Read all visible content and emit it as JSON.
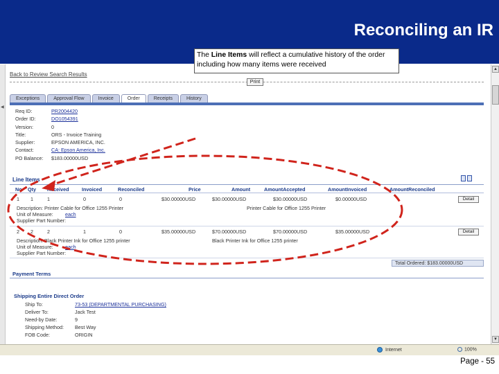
{
  "slide": {
    "title": "Reconciling an IR",
    "page": "Page - 55"
  },
  "nav": {
    "back_link": "Back to Review Search Results",
    "print_button": "Print"
  },
  "tabs": [
    "Exceptions",
    "Approval Flow",
    "Invoice",
    "Order",
    "Receipts",
    "History"
  ],
  "active_tab": "Order",
  "fields": [
    {
      "label": "Req ID:",
      "value": "PR2004420",
      "link": true
    },
    {
      "label": "Order ID:",
      "value": "DO1054391",
      "link": true
    },
    {
      "label": "Version:",
      "value": "0",
      "link": false
    },
    {
      "label": "Title:",
      "value": "ORS - Invoice Training",
      "link": false
    },
    {
      "label": "Supplier:",
      "value": "EPSON AMERICA, INC.",
      "link": false
    },
    {
      "label": "Contact:",
      "value": "CA: Epson America, Inc.",
      "link": true
    },
    {
      "label": "PO Balance:",
      "value": "$183.00000USD",
      "link": false
    }
  ],
  "callout": {
    "prefix": "The ",
    "bold": "Line Items",
    "suffix": " will reflect a cumulative history of the order including how many items were received"
  },
  "line_items": {
    "title": "Line Items",
    "columns": [
      "No",
      "Qty",
      "Received",
      "Invoiced",
      "Reconciled",
      "Price",
      "Amount",
      "AmountAccepted",
      "AmountInvoiced",
      "AmountReconciled"
    ],
    "rows": [
      {
        "no": "1",
        "qty": "1",
        "received": "1",
        "invoiced": "0",
        "reconciled": "0",
        "price": "$30.00000USD",
        "amount": "$30.00000USD",
        "amount_accepted": "$30.00000USD",
        "amount_invoiced": "$0.00000USD",
        "detail": "Detail",
        "description": "Description: Printer Cable for Office 1255 Printer",
        "description_right": "Printer Cable for Office 1255 Printer",
        "uom_label": "Unit of Measure:",
        "uom": "each",
        "part_label": "Supplier Part Number:"
      },
      {
        "no": "2",
        "qty": "2",
        "received": "2",
        "invoiced": "1",
        "reconciled": "0",
        "price": "$35.00000USD",
        "amount": "$70.00000USD",
        "amount_accepted": "$70.00000USD",
        "amount_invoiced": "$35.00000USD",
        "detail": "Detail",
        "description": "Description: Black Printer Ink for Office 1255 printer",
        "description_right": "Black Printer Ink for Office 1255 printer",
        "uom_label": "Unit of Measure:",
        "uom": "each",
        "part_label": "Supplier Part Number:"
      }
    ],
    "total_ordered": "Total Ordered: $183.00000USD"
  },
  "payment_terms": {
    "title": "Payment Terms"
  },
  "shipping": {
    "title": "Shipping  Entire Direct Order",
    "rows": [
      {
        "label": "Ship To:",
        "value": "73-53 (DEPARTMENTAL PURCHASING)",
        "link": true
      },
      {
        "label": "Deliver To:",
        "value": "Jack Test",
        "link": false
      },
      {
        "label": "Need-by Date:",
        "value": "9",
        "link": false
      },
      {
        "label": "Shipping Method:",
        "value": "Best Way",
        "link": false
      },
      {
        "label": "FOB Code:",
        "value": "ORIGIN",
        "link": false
      }
    ]
  },
  "statusbar": {
    "zone": "Internet",
    "zoom": "100%"
  },
  "colors": {
    "header_bg": "#0a2a8a",
    "accent_red": "#d0241c",
    "link": "#1a2f9a"
  }
}
